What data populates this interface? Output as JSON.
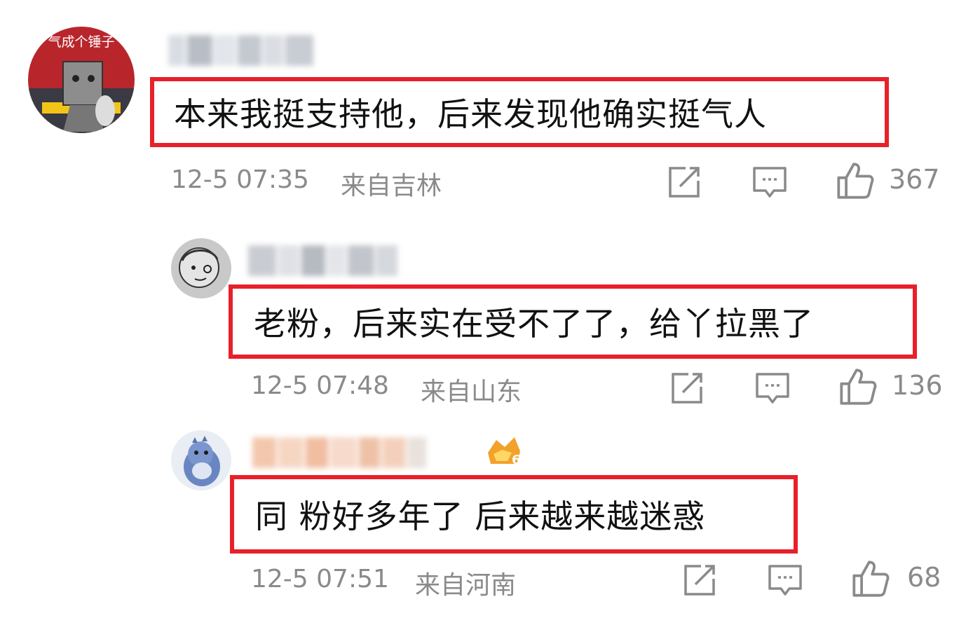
{
  "comments": [
    {
      "avatar_caption": "气成个锤子",
      "text": "本来我挺支持他，后来发现他确实挺气人",
      "time": "12-5 07:35",
      "location": "来自吉林",
      "likes": "367"
    },
    {
      "text": "老粉，后来实在受不了了，给丫拉黑了",
      "time": "12-5 07:48",
      "location": "来自山东",
      "likes": "136"
    },
    {
      "text": "同 粉好多年了 后来越来越迷惑",
      "time": "12-5 07:51",
      "location": "来自河南",
      "likes": "68"
    }
  ],
  "icons": {
    "share": "share-icon",
    "comment": "comment-icon",
    "like": "thumbs-up-icon"
  },
  "colors": {
    "highlight_border": "#e8202a",
    "meta_text": "#8a8a8a"
  }
}
